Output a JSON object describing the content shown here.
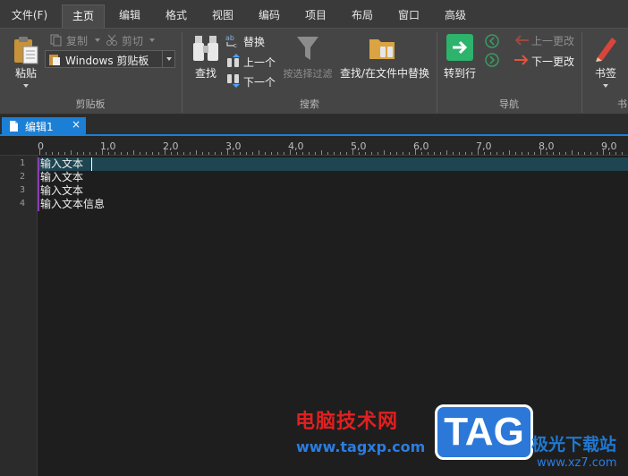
{
  "menu": {
    "tabs": [
      "文件(F)",
      "主页",
      "编辑",
      "格式",
      "视图",
      "编码",
      "项目",
      "布局",
      "窗口",
      "高级"
    ],
    "active": "主页"
  },
  "ribbon": {
    "clipboard": {
      "group_label": "剪贴板",
      "paste": "粘贴",
      "copy": "复制",
      "cut": "剪切",
      "clipboard_combo": "Windows 剪贴板"
    },
    "search": {
      "group_label": "搜索",
      "find": "查找",
      "replace": "替换",
      "prev": "上一个",
      "next": "下一个",
      "filter": "按选择过滤",
      "find_in_files": "查找/在文件中替换"
    },
    "navigation": {
      "group_label": "导航",
      "goto": "转到行",
      "prev_change": "上一更改",
      "next_change": "下一更改"
    },
    "bookmarks": {
      "label": "书签",
      "group_label_partial": "书"
    }
  },
  "document": {
    "tab_title": "编辑1",
    "close_glyph": "×"
  },
  "ruler": {
    "labels": [
      "0",
      "1,0",
      "2,0",
      "3,0",
      "4,0",
      "5,0",
      "6,0",
      "7,0",
      "8,0",
      "9,0"
    ]
  },
  "editor": {
    "line_numbers": [
      "1",
      "2",
      "3",
      "4"
    ],
    "lines": [
      "输入文本",
      "输入文本",
      "输入文本",
      "输入文本信息"
    ],
    "current_line": 1
  },
  "watermark": {
    "site_name": "电脑技术网",
    "url": "www.tagxp.com",
    "tag": "TAG",
    "brand": "极光下载站",
    "brand_url": "www.xz7.com"
  },
  "colors": {
    "accent": "#1c7fd6",
    "current_line": "#1f4552",
    "goto_green": "#2db36b",
    "next_change_red": "#e2553b",
    "bookmark_red": "#d9453a"
  }
}
